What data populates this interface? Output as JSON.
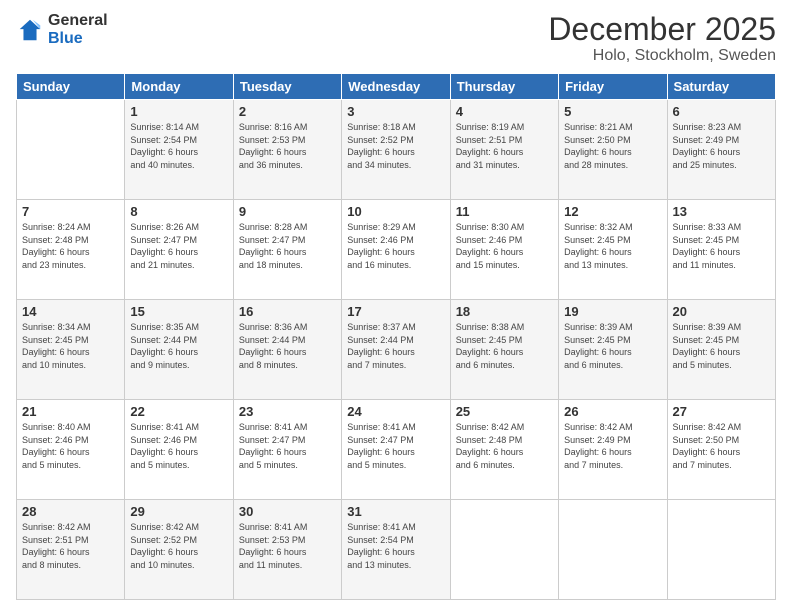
{
  "logo": {
    "general": "General",
    "blue": "Blue"
  },
  "header": {
    "month": "December 2025",
    "location": "Holo, Stockholm, Sweden"
  },
  "weekdays": [
    "Sunday",
    "Monday",
    "Tuesday",
    "Wednesday",
    "Thursday",
    "Friday",
    "Saturday"
  ],
  "weeks": [
    [
      {
        "day": "",
        "info": ""
      },
      {
        "day": "1",
        "info": "Sunrise: 8:14 AM\nSunset: 2:54 PM\nDaylight: 6 hours\nand 40 minutes."
      },
      {
        "day": "2",
        "info": "Sunrise: 8:16 AM\nSunset: 2:53 PM\nDaylight: 6 hours\nand 36 minutes."
      },
      {
        "day": "3",
        "info": "Sunrise: 8:18 AM\nSunset: 2:52 PM\nDaylight: 6 hours\nand 34 minutes."
      },
      {
        "day": "4",
        "info": "Sunrise: 8:19 AM\nSunset: 2:51 PM\nDaylight: 6 hours\nand 31 minutes."
      },
      {
        "day": "5",
        "info": "Sunrise: 8:21 AM\nSunset: 2:50 PM\nDaylight: 6 hours\nand 28 minutes."
      },
      {
        "day": "6",
        "info": "Sunrise: 8:23 AM\nSunset: 2:49 PM\nDaylight: 6 hours\nand 25 minutes."
      }
    ],
    [
      {
        "day": "7",
        "info": "Sunrise: 8:24 AM\nSunset: 2:48 PM\nDaylight: 6 hours\nand 23 minutes."
      },
      {
        "day": "8",
        "info": "Sunrise: 8:26 AM\nSunset: 2:47 PM\nDaylight: 6 hours\nand 21 minutes."
      },
      {
        "day": "9",
        "info": "Sunrise: 8:28 AM\nSunset: 2:47 PM\nDaylight: 6 hours\nand 18 minutes."
      },
      {
        "day": "10",
        "info": "Sunrise: 8:29 AM\nSunset: 2:46 PM\nDaylight: 6 hours\nand 16 minutes."
      },
      {
        "day": "11",
        "info": "Sunrise: 8:30 AM\nSunset: 2:46 PM\nDaylight: 6 hours\nand 15 minutes."
      },
      {
        "day": "12",
        "info": "Sunrise: 8:32 AM\nSunset: 2:45 PM\nDaylight: 6 hours\nand 13 minutes."
      },
      {
        "day": "13",
        "info": "Sunrise: 8:33 AM\nSunset: 2:45 PM\nDaylight: 6 hours\nand 11 minutes."
      }
    ],
    [
      {
        "day": "14",
        "info": "Sunrise: 8:34 AM\nSunset: 2:45 PM\nDaylight: 6 hours\nand 10 minutes."
      },
      {
        "day": "15",
        "info": "Sunrise: 8:35 AM\nSunset: 2:44 PM\nDaylight: 6 hours\nand 9 minutes."
      },
      {
        "day": "16",
        "info": "Sunrise: 8:36 AM\nSunset: 2:44 PM\nDaylight: 6 hours\nand 8 minutes."
      },
      {
        "day": "17",
        "info": "Sunrise: 8:37 AM\nSunset: 2:44 PM\nDaylight: 6 hours\nand 7 minutes."
      },
      {
        "day": "18",
        "info": "Sunrise: 8:38 AM\nSunset: 2:45 PM\nDaylight: 6 hours\nand 6 minutes."
      },
      {
        "day": "19",
        "info": "Sunrise: 8:39 AM\nSunset: 2:45 PM\nDaylight: 6 hours\nand 6 minutes."
      },
      {
        "day": "20",
        "info": "Sunrise: 8:39 AM\nSunset: 2:45 PM\nDaylight: 6 hours\nand 5 minutes."
      }
    ],
    [
      {
        "day": "21",
        "info": "Sunrise: 8:40 AM\nSunset: 2:46 PM\nDaylight: 6 hours\nand 5 minutes."
      },
      {
        "day": "22",
        "info": "Sunrise: 8:41 AM\nSunset: 2:46 PM\nDaylight: 6 hours\nand 5 minutes."
      },
      {
        "day": "23",
        "info": "Sunrise: 8:41 AM\nSunset: 2:47 PM\nDaylight: 6 hours\nand 5 minutes."
      },
      {
        "day": "24",
        "info": "Sunrise: 8:41 AM\nSunset: 2:47 PM\nDaylight: 6 hours\nand 5 minutes."
      },
      {
        "day": "25",
        "info": "Sunrise: 8:42 AM\nSunset: 2:48 PM\nDaylight: 6 hours\nand 6 minutes."
      },
      {
        "day": "26",
        "info": "Sunrise: 8:42 AM\nSunset: 2:49 PM\nDaylight: 6 hours\nand 7 minutes."
      },
      {
        "day": "27",
        "info": "Sunrise: 8:42 AM\nSunset: 2:50 PM\nDaylight: 6 hours\nand 7 minutes."
      }
    ],
    [
      {
        "day": "28",
        "info": "Sunrise: 8:42 AM\nSunset: 2:51 PM\nDaylight: 6 hours\nand 8 minutes."
      },
      {
        "day": "29",
        "info": "Sunrise: 8:42 AM\nSunset: 2:52 PM\nDaylight: 6 hours\nand 10 minutes."
      },
      {
        "day": "30",
        "info": "Sunrise: 8:41 AM\nSunset: 2:53 PM\nDaylight: 6 hours\nand 11 minutes."
      },
      {
        "day": "31",
        "info": "Sunrise: 8:41 AM\nSunset: 2:54 PM\nDaylight: 6 hours\nand 13 minutes."
      },
      {
        "day": "",
        "info": ""
      },
      {
        "day": "",
        "info": ""
      },
      {
        "day": "",
        "info": ""
      }
    ]
  ]
}
